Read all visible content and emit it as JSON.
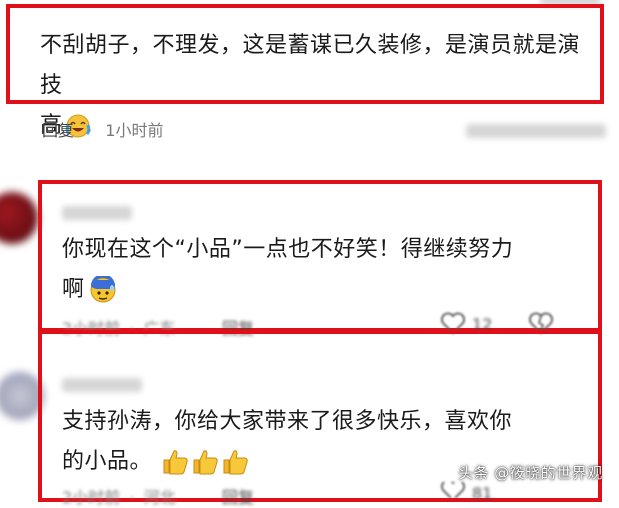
{
  "colors": {
    "highlight_box": "#e0101b",
    "meta_text": "#7a7a7a"
  },
  "comment1": {
    "line1": "不刮胡子，不理发，这是蓄谋已久装修，是演员就是演技",
    "line2": "高",
    "emoji": "laughing-crying-emoji",
    "reply_label": "回复",
    "separator": "·",
    "time": "1小时前"
  },
  "comment2": {
    "line1": "你现在这个“小品”一点也不好笑！得继续努力",
    "line2": "啊",
    "emoji": "blushing-sweat-emoji",
    "time": "2小时前",
    "separator": "·",
    "location": "广东",
    "reply_label": "回复",
    "likes": "12"
  },
  "comment3": {
    "line1": "支持孙涛，你给大家带来了很多快乐，喜欢你",
    "line2": "的小品。",
    "emojis": [
      "thumbs-up-emoji",
      "thumbs-up-emoji",
      "thumbs-up-emoji"
    ],
    "time": "2小时前",
    "separator": "·",
    "location": "河北",
    "reply_label": "回复",
    "likes": "81"
  },
  "watermark": "头条 @筱晓的世界观"
}
